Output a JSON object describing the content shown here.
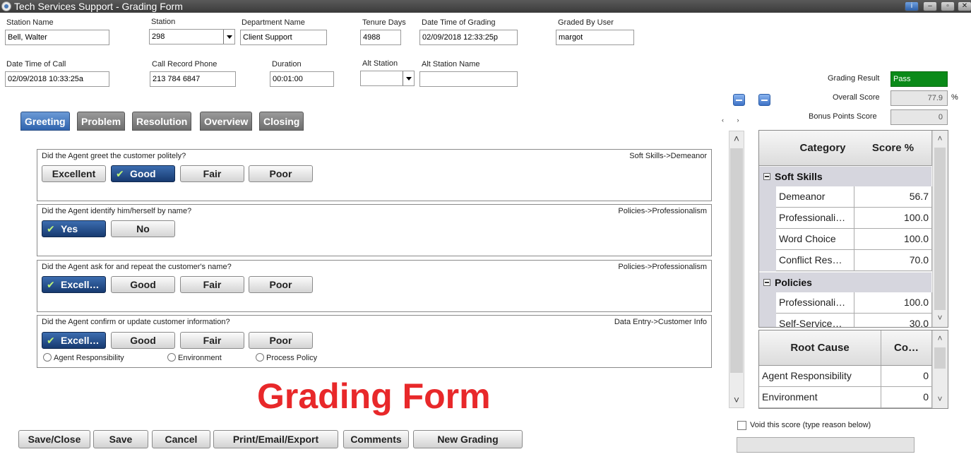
{
  "window": {
    "title": "Tech Services Support - Grading Form",
    "buttons": {
      "help": "i",
      "minimize": "–",
      "restore": "▫",
      "close": "✕"
    }
  },
  "fields": {
    "station_name": {
      "label": "Station Name",
      "value": "Bell, Walter"
    },
    "station": {
      "label": "Station",
      "value": "298"
    },
    "department_name": {
      "label": "Department Name",
      "value": "Client Support"
    },
    "tenure_days": {
      "label": "Tenure Days",
      "value": "4988"
    },
    "date_time_grading": {
      "label": "Date Time of Grading",
      "value": "02/09/2018 12:33:25p"
    },
    "graded_by": {
      "label": "Graded By User",
      "value": "margot"
    },
    "date_time_call": {
      "label": "Date Time of Call",
      "value": "02/09/2018 10:33:25a"
    },
    "call_record_phone": {
      "label": "Call Record Phone",
      "value": "213 784 6847"
    },
    "duration": {
      "label": "Duration",
      "value": "00:01:00"
    },
    "alt_station": {
      "label": "Alt Station",
      "value": ""
    },
    "alt_station_name": {
      "label": "Alt Station Name",
      "value": ""
    }
  },
  "scores": {
    "grading_result": {
      "label": "Grading Result",
      "value": "Pass",
      "color": "#0a8a18"
    },
    "overall_score": {
      "label": "Overall Score",
      "value": "77.9",
      "unit": "%"
    },
    "bonus_points": {
      "label": "Bonus Points Score",
      "value": "0"
    }
  },
  "tabs": [
    {
      "label": "Greeting",
      "active": true
    },
    {
      "label": "Problem",
      "active": false
    },
    {
      "label": "Resolution",
      "active": false
    },
    {
      "label": "Overview",
      "active": false
    },
    {
      "label": "Closing",
      "active": false
    }
  ],
  "questions": [
    {
      "text": "Did the Agent greet the customer politely?",
      "category": "Soft Skills->Demeanor",
      "answers": [
        "Excellent",
        "Good",
        "Fair",
        "Poor"
      ],
      "selected": 1
    },
    {
      "text": "Did the Agent identify him/herself by name?",
      "category": "Policies->Professionalism",
      "answers": [
        "Yes",
        "No"
      ],
      "selected": 0
    },
    {
      "text": "Did the Agent ask for and repeat the customer's name?",
      "category": "Policies->Professionalism",
      "answers": [
        "Excell…",
        "Good",
        "Fair",
        "Poor"
      ],
      "selected": 0
    },
    {
      "text": "Did the Agent confirm or update customer information?",
      "category": "Data Entry->Customer Info",
      "answers": [
        "Excell…",
        "Good",
        "Fair",
        "Poor"
      ],
      "selected": 0,
      "radios": [
        "Agent Responsibility",
        "Environment",
        "Process Policy"
      ]
    }
  ],
  "check_glyph": "✔",
  "watermark": "Grading Form",
  "bottom_buttons": [
    "Save/Close",
    "Save",
    "Cancel",
    "Print/Email/Export",
    "Comments",
    "New Grading"
  ],
  "category_grid": {
    "headers": [
      "Category",
      "Score %"
    ],
    "groups": [
      {
        "name": "Soft Skills",
        "rows": [
          {
            "name": "Demeanor",
            "score": "56.7"
          },
          {
            "name": "Professionali…",
            "score": "100.0"
          },
          {
            "name": "Word Choice",
            "score": "100.0"
          },
          {
            "name": "Conflict Res…",
            "score": "70.0"
          }
        ]
      },
      {
        "name": "Policies",
        "rows": [
          {
            "name": "Professionali…",
            "score": "100.0"
          },
          {
            "name": "Self-Service…",
            "score": "30.0"
          }
        ]
      }
    ]
  },
  "root_cause_grid": {
    "headers": [
      "Root Cause",
      "Co…"
    ],
    "rows": [
      {
        "name": "Agent Responsibility",
        "count": "0"
      },
      {
        "name": "Environment",
        "count": "0"
      }
    ]
  },
  "void": {
    "label": "Void this score (type reason below)",
    "reason": ""
  },
  "scroll_glyphs": {
    "up": "˄",
    "down": "˅",
    "left_right": "‹ ›"
  }
}
